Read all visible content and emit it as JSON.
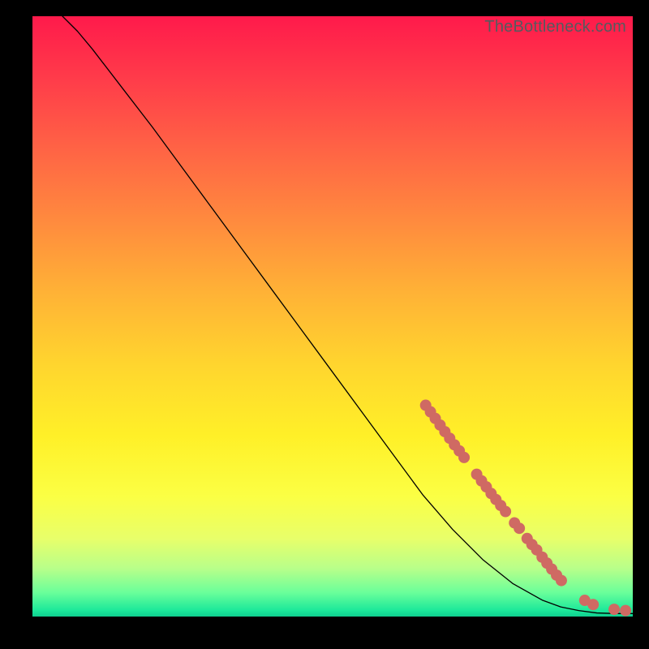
{
  "watermark": "TheBottleneck.com",
  "chart_data": {
    "type": "line",
    "title": "",
    "xlabel": "",
    "ylabel": "",
    "xlim": [
      0,
      100
    ],
    "ylim": [
      0,
      100
    ],
    "grid": false,
    "legend": false,
    "series": [
      {
        "name": "curve",
        "x": [
          5,
          7.5,
          10,
          15,
          20,
          25,
          30,
          35,
          40,
          45,
          50,
          55,
          60,
          65,
          70,
          75,
          80,
          85,
          88,
          91,
          94,
          97,
          100
        ],
        "y": [
          100,
          97.5,
          94.5,
          88,
          81.5,
          74.7,
          67.9,
          61.1,
          54.3,
          47.5,
          40.7,
          33.9,
          27.1,
          20.3,
          14.5,
          9.5,
          5.5,
          2.7,
          1.6,
          1.0,
          0.6,
          0.5,
          0.5
        ],
        "color": "#000000",
        "linewidth": 1.3
      }
    ],
    "markers": [
      {
        "name": "cluster-a",
        "color": "#cf6a63",
        "radius": 7,
        "points": [
          {
            "x": 65.5,
            "y": 35.2
          },
          {
            "x": 66.3,
            "y": 34.1
          },
          {
            "x": 67.1,
            "y": 33.0
          },
          {
            "x": 67.9,
            "y": 31.9
          },
          {
            "x": 68.7,
            "y": 30.8
          },
          {
            "x": 69.5,
            "y": 29.7
          },
          {
            "x": 70.3,
            "y": 28.6
          },
          {
            "x": 71.1,
            "y": 27.6
          },
          {
            "x": 71.9,
            "y": 26.5
          },
          {
            "x": 74.0,
            "y": 23.7
          },
          {
            "x": 74.8,
            "y": 22.6
          },
          {
            "x": 75.6,
            "y": 21.6
          },
          {
            "x": 76.4,
            "y": 20.5
          },
          {
            "x": 77.2,
            "y": 19.5
          },
          {
            "x": 78.0,
            "y": 18.5
          },
          {
            "x": 78.8,
            "y": 17.5
          },
          {
            "x": 80.3,
            "y": 15.6
          },
          {
            "x": 81.1,
            "y": 14.7
          },
          {
            "x": 82.4,
            "y": 13.0
          },
          {
            "x": 83.2,
            "y": 12.0
          },
          {
            "x": 84.0,
            "y": 11.1
          },
          {
            "x": 84.9,
            "y": 9.9
          },
          {
            "x": 85.7,
            "y": 8.9
          },
          {
            "x": 86.5,
            "y": 7.9
          },
          {
            "x": 87.3,
            "y": 6.9
          },
          {
            "x": 88.1,
            "y": 6.0
          }
        ]
      },
      {
        "name": "cluster-b",
        "color": "#cf6a63",
        "radius": 7,
        "points": [
          {
            "x": 92.0,
            "y": 2.7
          },
          {
            "x": 93.4,
            "y": 2.0
          },
          {
            "x": 96.9,
            "y": 1.2
          },
          {
            "x": 98.8,
            "y": 1.0
          }
        ]
      }
    ]
  }
}
